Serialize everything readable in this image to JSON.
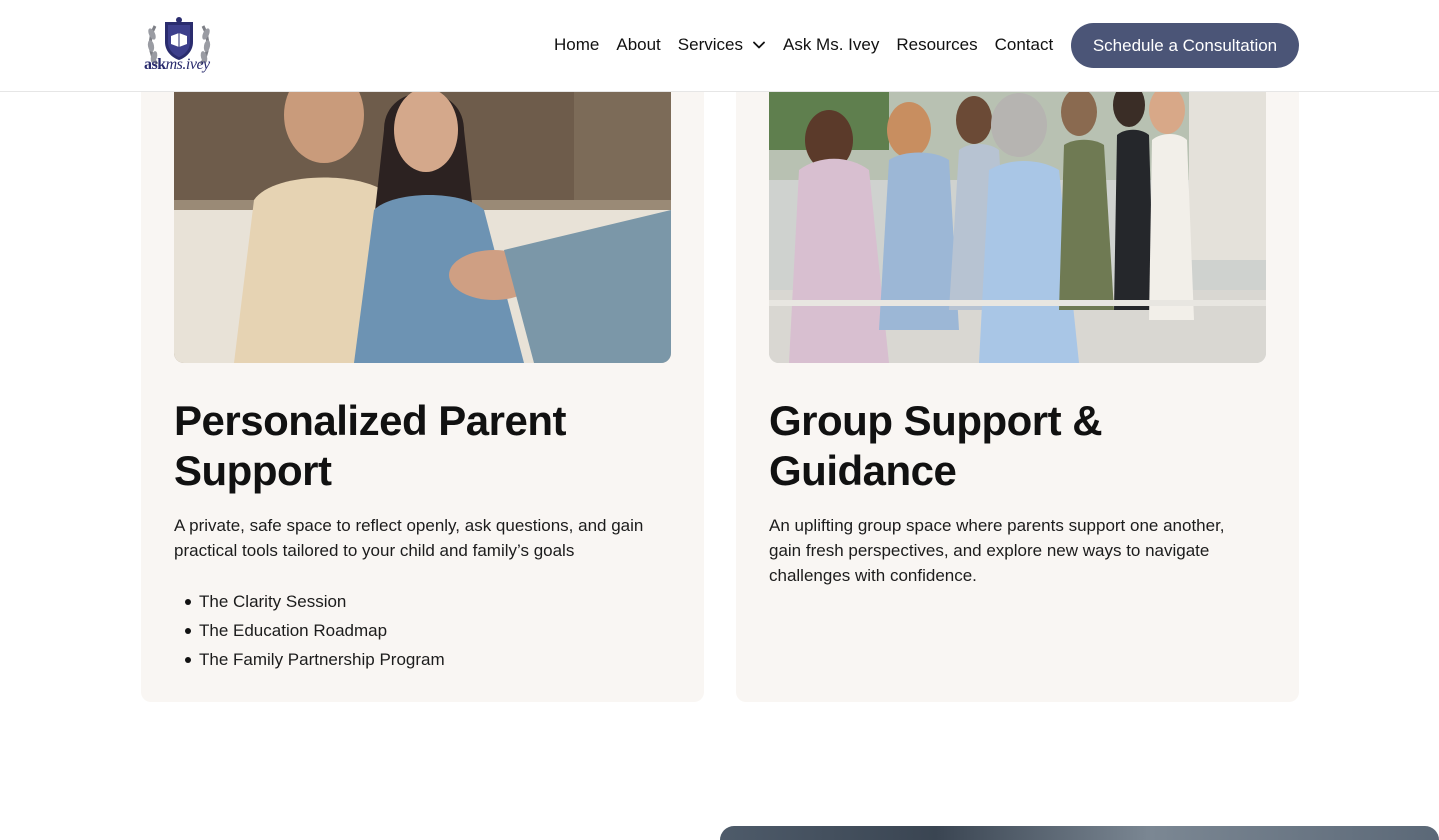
{
  "header": {
    "logo_text_bold": "ask",
    "logo_text_light": "ms.ivey",
    "nav": [
      {
        "label": "Home"
      },
      {
        "label": "About"
      },
      {
        "label": "Services"
      },
      {
        "label": "Ask Ms. Ivey"
      },
      {
        "label": "Resources"
      },
      {
        "label": "Contact"
      }
    ],
    "cta_label": "Schedule a Consultation"
  },
  "cards": [
    {
      "title": "Personalized Parent Support",
      "description": "A private, safe space to reflect openly, ask questions, and gain practical tools tailored to your child and family’s goals",
      "items": [
        "The Clarity Session",
        "The Education Roadmap",
        "The Family Partnership Program"
      ]
    },
    {
      "title": "Group Support & Guidance",
      "description": "An uplifting group space where parents support one another, gain fresh perspectives, and explore new ways to navigate challenges with confidence."
    }
  ],
  "colors": {
    "accent": "#4b5577",
    "card_bg": "#f9f6f3",
    "logo_navy": "#2a2c6e"
  }
}
